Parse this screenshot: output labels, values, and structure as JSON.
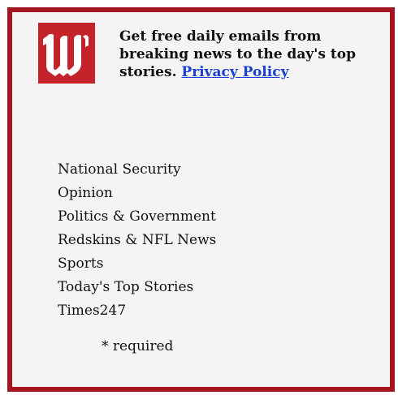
{
  "widget": {
    "logo_icon": "washington-times-w-logo",
    "brand_color": "#a3161f",
    "logo_color": "#c4232b",
    "link_color": "#1a3fd6",
    "headline_text": "Get free daily emails from breaking news to the day's top stories.",
    "privacy_link_label": "Privacy Policy"
  },
  "topics": [
    {
      "label": "National Security"
    },
    {
      "label": "Opinion"
    },
    {
      "label": "Politics & Government"
    },
    {
      "label": "Redskins & NFL News"
    },
    {
      "label": "Sports"
    },
    {
      "label": "Today's Top Stories"
    },
    {
      "label": "Times247"
    }
  ],
  "form": {
    "required_note": "* required"
  }
}
